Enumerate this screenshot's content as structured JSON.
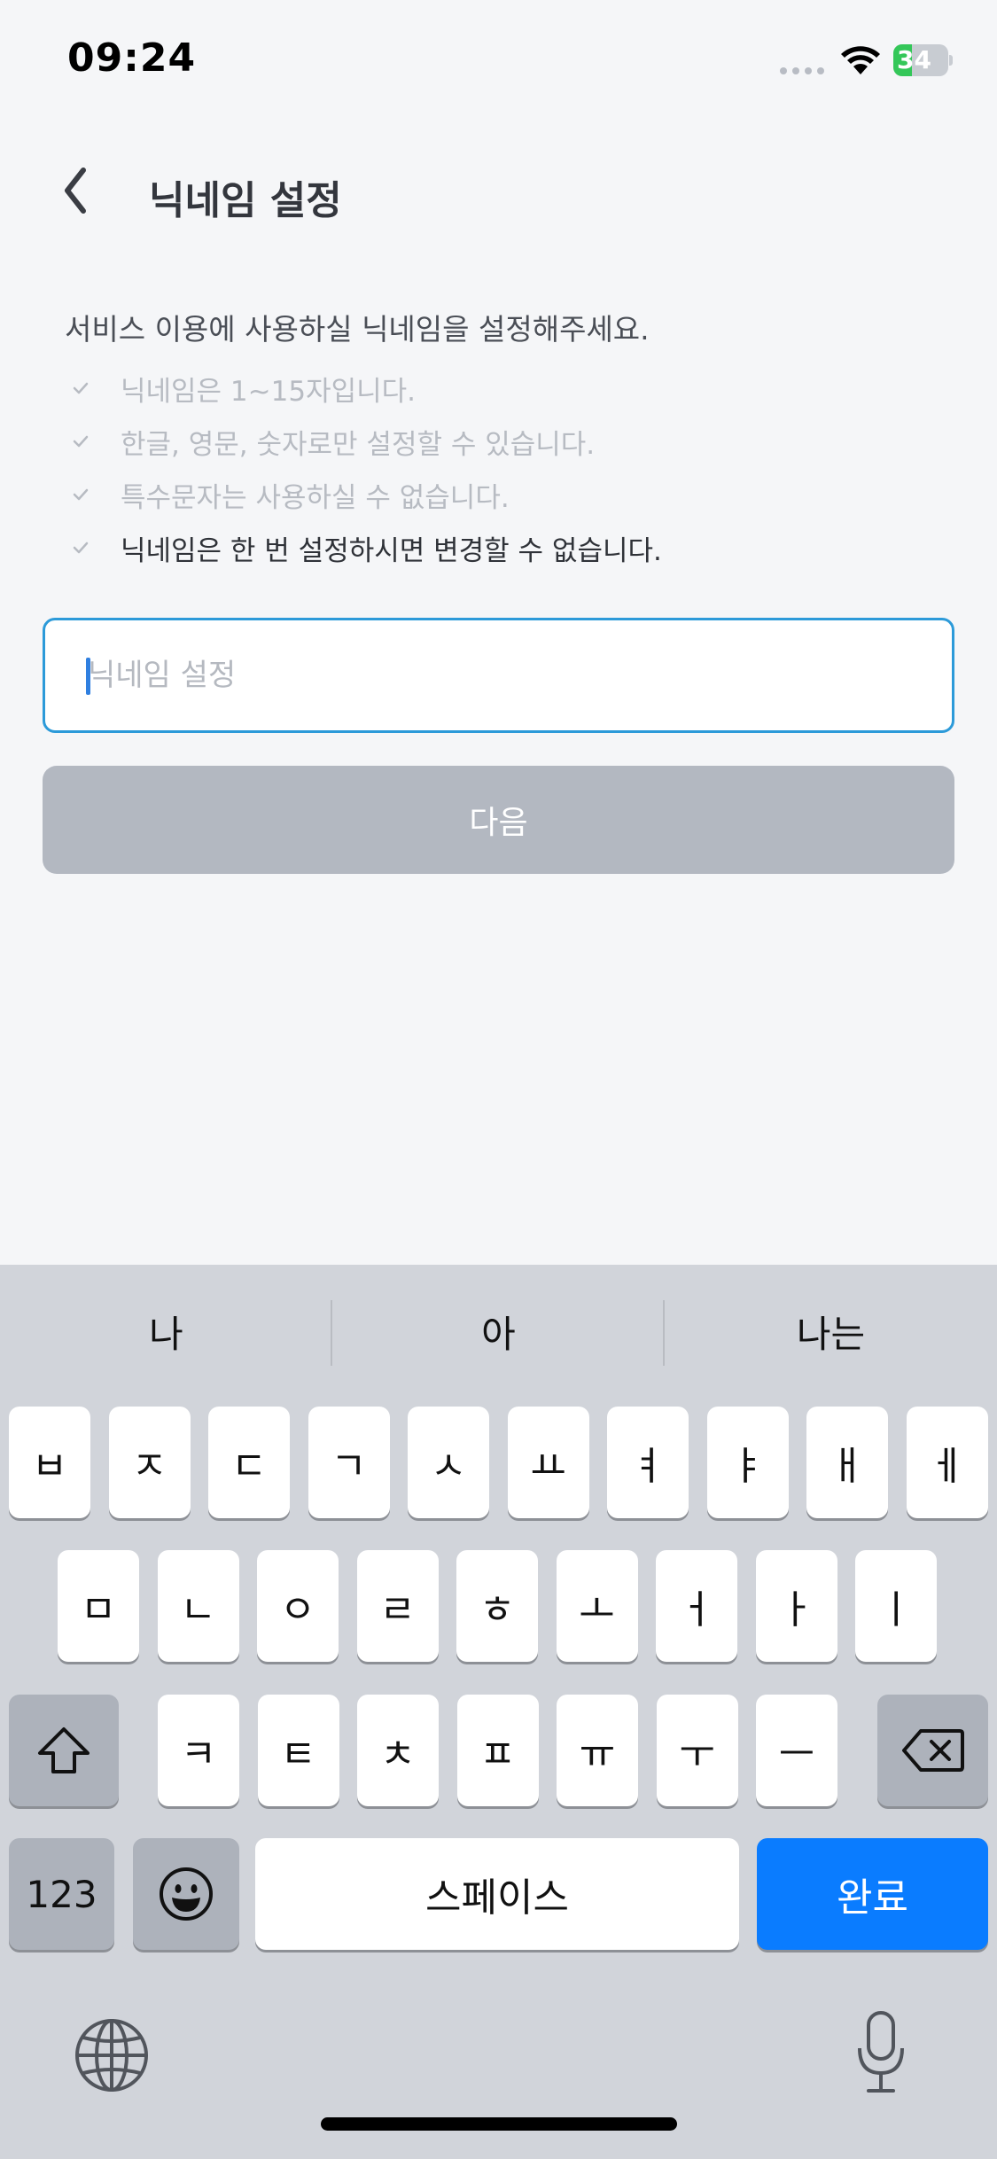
{
  "status_bar": {
    "time": "09:24",
    "battery": "34",
    "battery_level": 0.34
  },
  "header": {
    "title": "닉네임 설정"
  },
  "instructions": {
    "intro": "서비스 이용에 사용하실 닉네임을 설정해주세요.",
    "rules": [
      "닉네임은 1~15자입니다.",
      "한글, 영문, 숫자로만 설정할 수 있습니다.",
      "특수문자는 사용하실 수 없습니다.",
      "닉네임은 한 번 설정하시면 변경할 수 없습니다."
    ]
  },
  "nickname_input": {
    "value": "",
    "placeholder": "닉네임 설정"
  },
  "next_button": {
    "label": "다음"
  },
  "keyboard": {
    "suggestions": [
      "나",
      "아",
      "나는"
    ],
    "row1": [
      "ㅂ",
      "ㅈ",
      "ㄷ",
      "ㄱ",
      "ㅅ",
      "ㅛ",
      "ㅕ",
      "ㅑ",
      "ㅐ",
      "ㅔ"
    ],
    "row2": [
      "ㅁ",
      "ㄴ",
      "ㅇ",
      "ㄹ",
      "ㅎ",
      "ㅗ",
      "ㅓ",
      "ㅏ",
      "ㅣ"
    ],
    "row3": [
      "ㅋ",
      "ㅌ",
      "ㅊ",
      "ㅍ",
      "ㅠ",
      "ㅜ",
      "ㅡ"
    ],
    "numbers_key": "123",
    "space_key": "스페이스",
    "done_key": "완료",
    "icons": {
      "shift": "shift-icon",
      "delete": "delete-icon",
      "emoji": "emoji-icon",
      "globe": "globe-icon",
      "mic": "mic-icon"
    }
  },
  "colors": {
    "accent": "#0a7cff",
    "input_border": "#2c9ad9",
    "disabled_button": "#b3b8c1"
  }
}
